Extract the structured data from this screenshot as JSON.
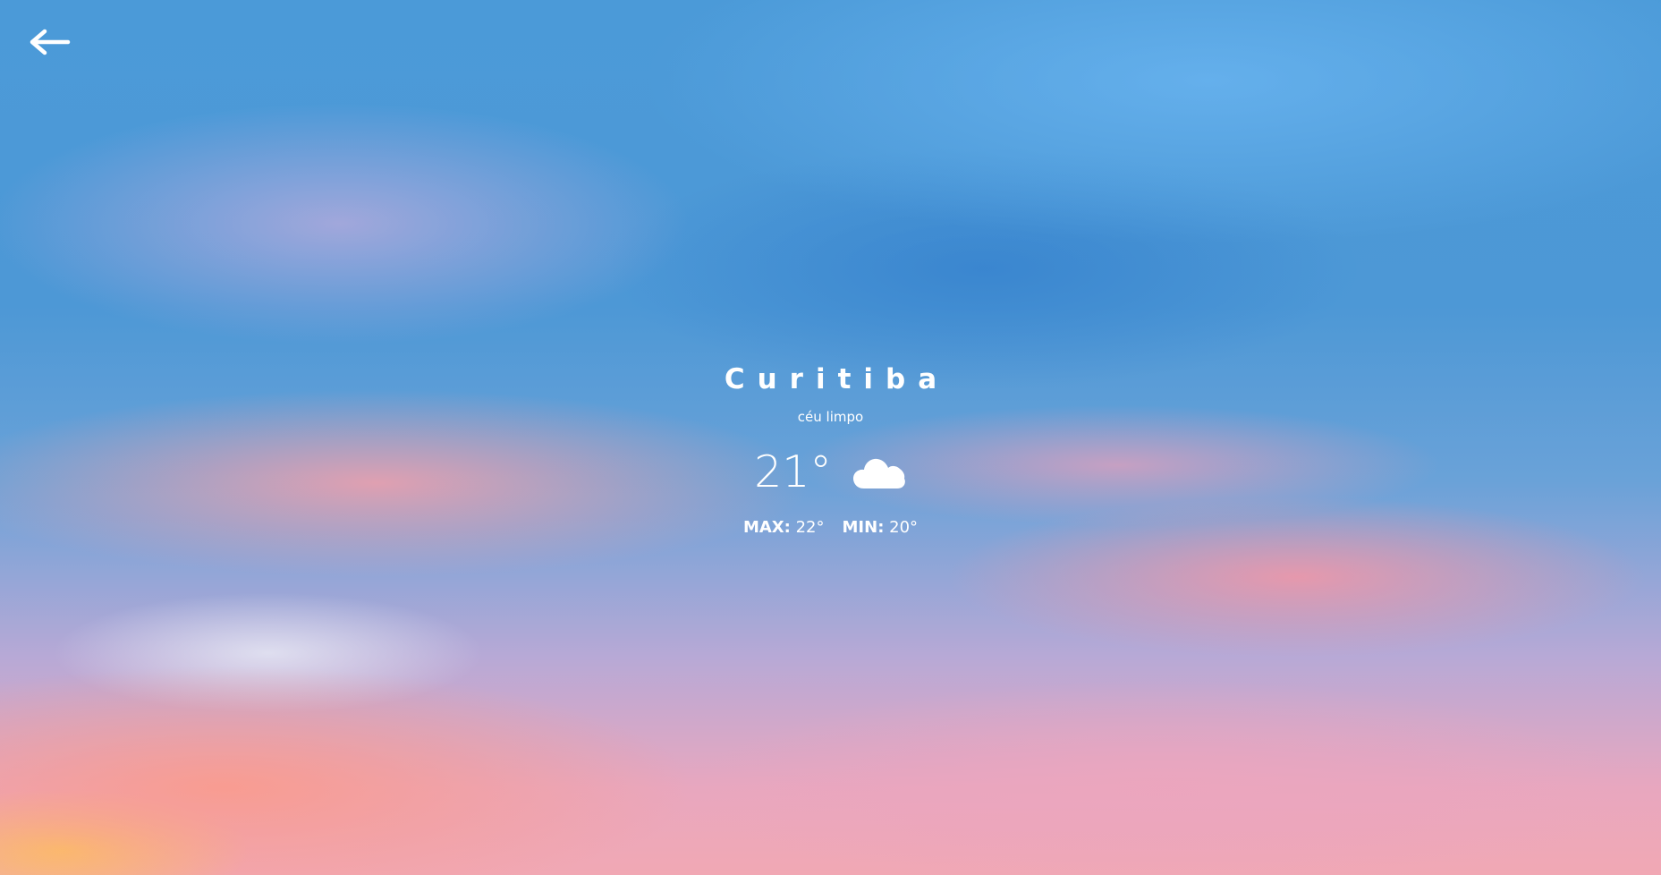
{
  "background": {
    "description_colors": {
      "sky_blue": "#4d98d6",
      "pink": "#f1a8b4",
      "gold": "#fcc85a"
    }
  },
  "nav": {
    "back_icon": "arrow-left-icon"
  },
  "weather": {
    "city": "Curitiba",
    "condition": "céu limpo",
    "temperature": "21°",
    "icon": "cloud-icon",
    "max_label": "MAX:",
    "max_value": "22°",
    "min_label": "MIN:",
    "min_value": "20°"
  }
}
